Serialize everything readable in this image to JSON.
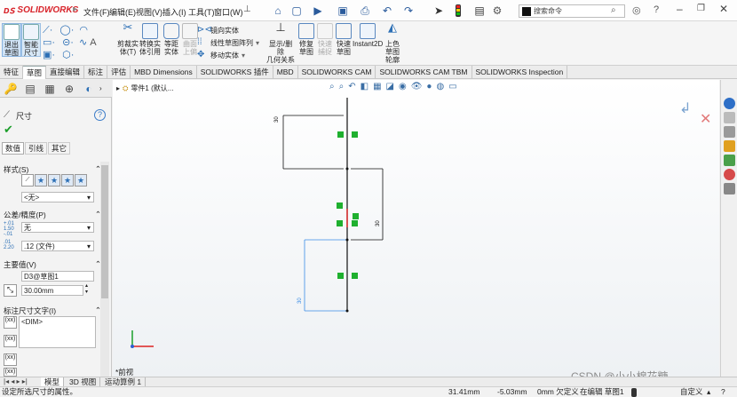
{
  "app": {
    "logo_text": "SOLIDWORKS",
    "brand_color": "#d8232a"
  },
  "menu": [
    "文件(F)",
    "编辑(E)",
    "视图(V)",
    "插入(I)",
    "工具(T)",
    "窗口(W)"
  ],
  "search": {
    "placeholder": "搜索命令"
  },
  "commands": {
    "exit_sketch": [
      "退出",
      "草图"
    ],
    "smart_dim": [
      "智能",
      "尺寸"
    ],
    "trim": [
      "剪裁实",
      "体(T)"
    ],
    "convert": [
      "转换实",
      "体引用"
    ],
    "offset": [
      "等距",
      "实体"
    ],
    "surface_offset": [
      "曲面",
      "上偏"
    ],
    "mirror": "镜向实体",
    "linear_pattern": "线性草图阵列",
    "move": "移动实体",
    "show_delete": [
      "显示/删除",
      "几何关系"
    ],
    "repair": [
      "修复",
      "草图"
    ],
    "quick_snap": [
      "快速",
      "捕捉"
    ],
    "quick_sketch": [
      "快速",
      "草图"
    ],
    "instant2d": "Instant2D",
    "shaded": [
      "上色",
      "草图",
      "轮廓"
    ]
  },
  "tabs": [
    "特征",
    "草图",
    "直接编辑",
    "标注",
    "评估",
    "MBD Dimensions",
    "SOLIDWORKS 插件",
    "MBD",
    "SOLIDWORKS CAM",
    "SOLIDWORKS CAM TBM",
    "SOLIDWORKS Inspection"
  ],
  "active_tab": "草图",
  "property_manager": {
    "title": "尺寸",
    "subtabs": [
      "数值",
      "引线",
      "其它"
    ],
    "style": {
      "header": "样式(S)",
      "value": "<无>"
    },
    "tolerance": {
      "header": "公差/精度(P)",
      "tol_value": "无",
      "precision_value": ".12 (文件)"
    },
    "primary": {
      "header": "主要值(V)",
      "name": "D3@草图1",
      "value": "30.00mm"
    },
    "dim_text": {
      "header": "标注尺寸文字(I)",
      "text": "<DIM>"
    }
  },
  "tree": {
    "label": "零件1 (默认..."
  },
  "dimensions": {
    "d1": "30",
    "d2": "30",
    "d3": "30"
  },
  "view_label": "*前视",
  "bottom_tabs": [
    "模型",
    "3D 视图",
    "运动算例 1"
  ],
  "status": {
    "message": "设定所选尺寸的属性。",
    "x": "31.41mm",
    "y": "-5.03mm",
    "z": "0mm 欠定义",
    "editing": "在编辑 草图1",
    "custom": "自定义"
  },
  "watermark": "CSDN @小小棉花糖",
  "colors": {
    "relation_green": "#1fb02f",
    "sketch_blue": "#2d7be0",
    "selected_blue": "#3a8ce6"
  }
}
